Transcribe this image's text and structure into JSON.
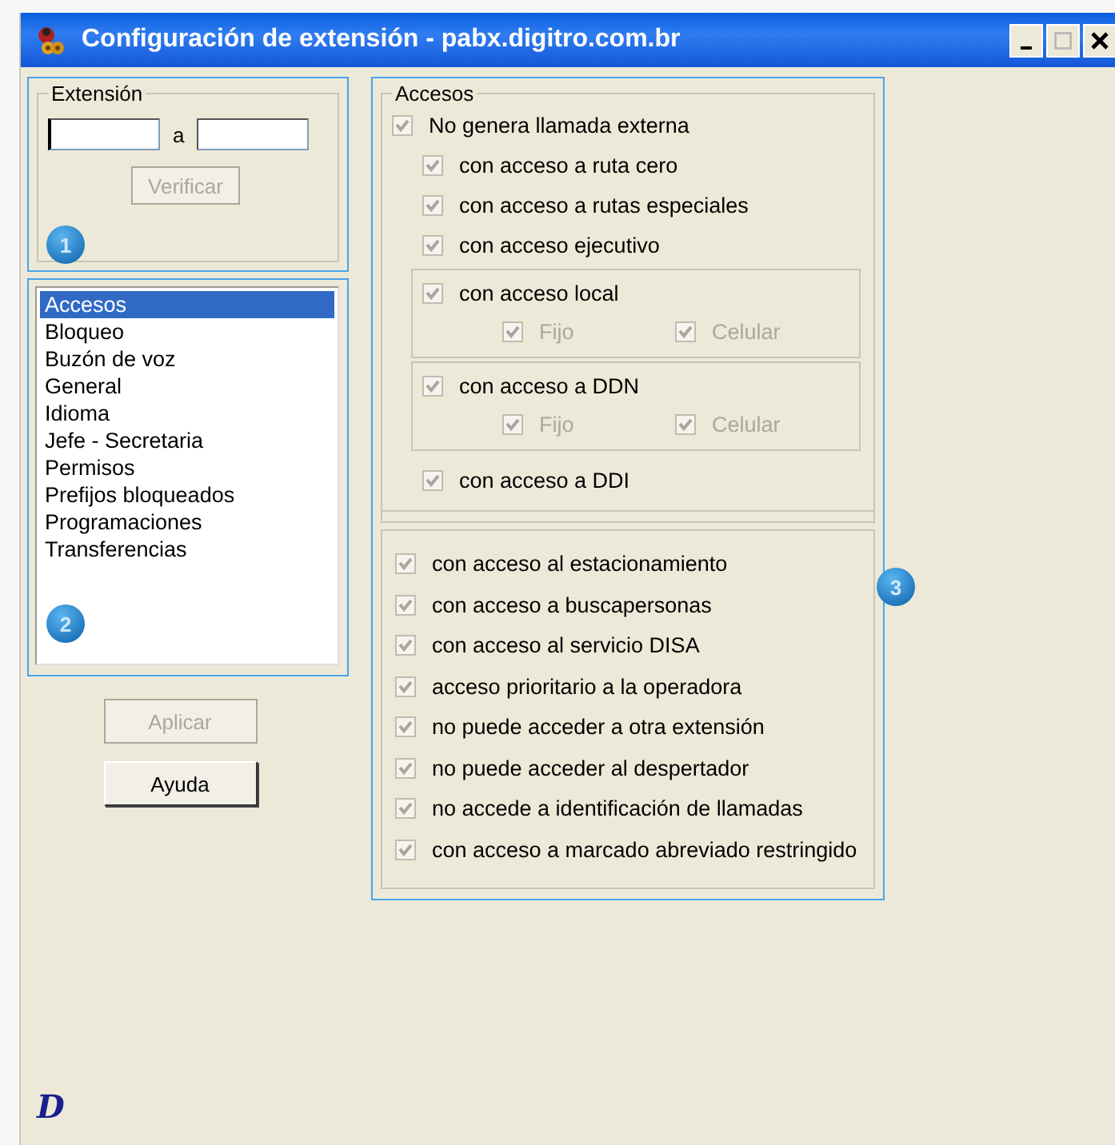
{
  "window": {
    "title": "Configuración de extensión - pabx.digitro.com.br"
  },
  "extension": {
    "legend": "Extensión",
    "from": {
      "focused": true
    },
    "separator": "a",
    "to": {
      "focused": false
    },
    "button": {
      "label": "Verificar",
      "disabled": true
    },
    "badge": "1"
  },
  "sections": {
    "badge": "2",
    "items": [
      {
        "label": "Accesos",
        "selected": true
      },
      {
        "label": "Bloqueo",
        "selected": false
      },
      {
        "label": "Buzón de voz",
        "selected": false
      },
      {
        "label": "General",
        "selected": false
      },
      {
        "label": "Idioma",
        "selected": false
      },
      {
        "label": "Jefe - Secretaria",
        "selected": false
      },
      {
        "label": "Permisos",
        "selected": false
      },
      {
        "label": "Prefijos bloqueados",
        "selected": false
      },
      {
        "label": "Programaciones",
        "selected": false
      },
      {
        "label": "Transferencias",
        "selected": false
      }
    ]
  },
  "buttons": [
    {
      "label": "Aplicar",
      "disabled": true
    },
    {
      "label": "Ayuda",
      "disabled": false
    }
  ],
  "accesos": {
    "legend": "Accesos",
    "badge": "3",
    "main": {
      "label": "No genera llamada externa",
      "checked": true,
      "disabled": false
    },
    "items": [
      {
        "kind": "check",
        "label": "con acceso a ruta cero",
        "checked": true,
        "disabled": false
      },
      {
        "kind": "check",
        "label": "con acceso a rutas especiales",
        "checked": true,
        "disabled": false
      },
      {
        "kind": "check",
        "label": "con acceso ejecutivo",
        "checked": true,
        "disabled": false
      },
      {
        "kind": "group",
        "label": "con acceso local",
        "checked": true,
        "disabled": false,
        "children": [
          {
            "label": "Fijo",
            "checked": true,
            "disabled": true
          },
          {
            "label": "Celular",
            "checked": true,
            "disabled": true
          }
        ]
      },
      {
        "kind": "group",
        "label": "con acceso a DDN",
        "checked": true,
        "disabled": false,
        "children": [
          {
            "label": "Fijo",
            "checked": true,
            "disabled": true
          },
          {
            "label": "Celular",
            "checked": true,
            "disabled": true
          }
        ]
      },
      {
        "kind": "check",
        "label": "con acceso a DDI",
        "checked": true,
        "disabled": false
      }
    ],
    "extra": [
      {
        "label": "con acceso al estacionamiento",
        "checked": true,
        "disabled": false
      },
      {
        "label": "con acceso a buscapersonas",
        "checked": true,
        "disabled": false
      },
      {
        "label": "con acceso al servicio DISA",
        "checked": true,
        "disabled": false
      },
      {
        "label": "acceso prioritario a la operadora",
        "checked": true,
        "disabled": false
      },
      {
        "label": "no puede acceder a otra extensión",
        "checked": true,
        "disabled": false
      },
      {
        "label": "no puede acceder al despertador",
        "checked": true,
        "disabled": false
      },
      {
        "label": "no accede a identificación de llamadas",
        "checked": true,
        "disabled": false
      },
      {
        "label": "con acceso a marcado abreviado restringido",
        "checked": true,
        "disabled": false
      }
    ]
  },
  "logo": "D"
}
